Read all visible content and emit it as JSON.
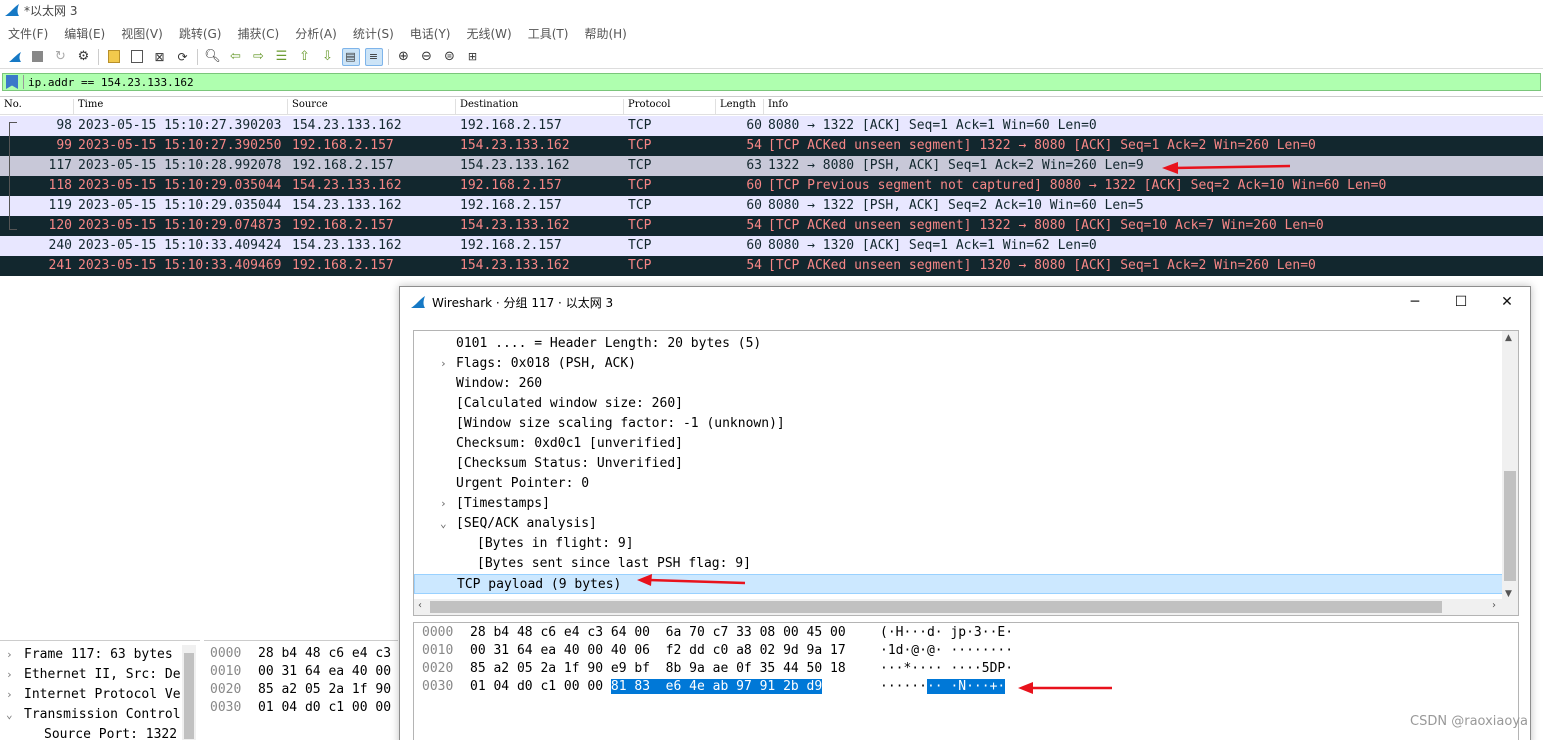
{
  "window": {
    "title": "*以太网 3"
  },
  "menu": [
    "文件(F)",
    "编辑(E)",
    "视图(V)",
    "跳转(G)",
    "捕获(C)",
    "分析(A)",
    "统计(S)",
    "电话(Y)",
    "无线(W)",
    "工具(T)",
    "帮助(H)"
  ],
  "filter": {
    "value": "ip.addr == 154.23.133.162"
  },
  "columns": [
    "No.",
    "Time",
    "Source",
    "Destination",
    "Protocol",
    "Length",
    "Info"
  ],
  "packets": [
    {
      "no": "98",
      "time": "2023-05-15 15:10:27.390203",
      "src": "154.23.133.162",
      "dst": "192.168.2.157",
      "proto": "TCP",
      "len": "60",
      "info": "8080 → 1322 [ACK] Seq=1 Ack=1 Win=60 Len=0",
      "style": "light"
    },
    {
      "no": "99",
      "time": "2023-05-15 15:10:27.390250",
      "src": "192.168.2.157",
      "dst": "154.23.133.162",
      "proto": "TCP",
      "len": "54",
      "info": "[TCP ACKed unseen segment] 1322 → 8080 [ACK] Seq=1 Ack=2 Win=260 Len=0",
      "style": "dark"
    },
    {
      "no": "117",
      "time": "2023-05-15 15:10:28.992078",
      "src": "192.168.2.157",
      "dst": "154.23.133.162",
      "proto": "TCP",
      "len": "63",
      "info": "1322 → 8080 [PSH, ACK] Seq=1 Ack=2 Win=260 Len=9",
      "style": "sel"
    },
    {
      "no": "118",
      "time": "2023-05-15 15:10:29.035044",
      "src": "154.23.133.162",
      "dst": "192.168.2.157",
      "proto": "TCP",
      "len": "60",
      "info": "[TCP Previous segment not captured] 8080 → 1322 [ACK] Seq=2 Ack=10 Win=60 Len=0",
      "style": "dark"
    },
    {
      "no": "119",
      "time": "2023-05-15 15:10:29.035044",
      "src": "154.23.133.162",
      "dst": "192.168.2.157",
      "proto": "TCP",
      "len": "60",
      "info": "8080 → 1322 [PSH, ACK] Seq=2 Ack=10 Win=60 Len=5",
      "style": "light"
    },
    {
      "no": "120",
      "time": "2023-05-15 15:10:29.074873",
      "src": "192.168.2.157",
      "dst": "154.23.133.162",
      "proto": "TCP",
      "len": "54",
      "info": "[TCP ACKed unseen segment] 1322 → 8080 [ACK] Seq=10 Ack=7 Win=260 Len=0",
      "style": "dark"
    },
    {
      "no": "240",
      "time": "2023-05-15 15:10:33.409424",
      "src": "154.23.133.162",
      "dst": "192.168.2.157",
      "proto": "TCP",
      "len": "60",
      "info": "8080 → 1320 [ACK] Seq=1 Ack=1 Win=62 Len=0",
      "style": "light"
    },
    {
      "no": "241",
      "time": "2023-05-15 15:10:33.409469",
      "src": "192.168.2.157",
      "dst": "154.23.133.162",
      "proto": "TCP",
      "len": "54",
      "info": "[TCP ACKed unseen segment] 1320 → 8080 [ACK] Seq=1 Ack=2 Win=260 Len=0",
      "style": "dark"
    }
  ],
  "detail_pane": [
    {
      "chev": "›",
      "text": "Frame 117: 63 bytes"
    },
    {
      "chev": "›",
      "text": "Ethernet II, Src: De"
    },
    {
      "chev": "›",
      "text": "Internet Protocol Ve"
    },
    {
      "chev": "⌄",
      "text": "Transmission Control"
    },
    {
      "chev": "",
      "text": "Source Port: 1322"
    }
  ],
  "bytes_pane": [
    {
      "off": "0000",
      "hex": "28 b4 48 c6 e4 c3"
    },
    {
      "off": "0010",
      "hex": "00 31 64 ea 40 00"
    },
    {
      "off": "0020",
      "hex": "85 a2 05 2a 1f 90"
    },
    {
      "off": "0030",
      "hex": "01 04 d0 c1 00 00"
    }
  ],
  "dialog": {
    "title": "Wireshark · 分组 117 · 以太网 3",
    "tree": [
      {
        "chev": "",
        "indent": 0,
        "text": "0101 .... = Header Length: 20 bytes (5)"
      },
      {
        "chev": "›",
        "indent": 0,
        "text": "Flags: 0x018 (PSH, ACK)"
      },
      {
        "chev": "",
        "indent": 0,
        "text": "Window: 260"
      },
      {
        "chev": "",
        "indent": 0,
        "text": "[Calculated window size: 260]"
      },
      {
        "chev": "",
        "indent": 0,
        "text": "[Window size scaling factor: -1 (unknown)]"
      },
      {
        "chev": "",
        "indent": 0,
        "text": "Checksum: 0xd0c1 [unverified]"
      },
      {
        "chev": "",
        "indent": 0,
        "text": "[Checksum Status: Unverified]"
      },
      {
        "chev": "",
        "indent": 0,
        "text": "Urgent Pointer: 0"
      },
      {
        "chev": "›",
        "indent": 0,
        "text": "[Timestamps]"
      },
      {
        "chev": "⌄",
        "indent": 0,
        "text": "[SEQ/ACK analysis]"
      },
      {
        "chev": "",
        "indent": 1,
        "text": "[Bytes in flight: 9]"
      },
      {
        "chev": "",
        "indent": 1,
        "text": "[Bytes sent since last PSH flag: 9]"
      },
      {
        "chev": "",
        "indent": 0,
        "text": "TCP payload (9 bytes)",
        "selected": true
      }
    ],
    "bytes": [
      {
        "off": "0000",
        "hex": "28 b4 48 c6 e4 c3 64 00  6a 70 c7 33 08 00 45 00",
        "asc": "(·H···d· jp·3··E·"
      },
      {
        "off": "0010",
        "hex": "00 31 64 ea 40 00 40 06  f2 dd c0 a8 02 9d 9a 17",
        "asc": "·1d·@·@· ········"
      },
      {
        "off": "0020",
        "hex": "85 a2 05 2a 1f 90 e9 bf  8b 9a ae 0f 35 44 50 18",
        "asc": "···*···· ····5DP·"
      },
      {
        "off": "0030",
        "hex_plain": "01 04 d0 c1 00 00 ",
        "hex_hl": "81 83  e6 4e ab 97 91 2b d9",
        "asc_plain": "······",
        "asc_hl": "·· ·N···+·"
      }
    ]
  },
  "watermark": "CSDN @raoxiaoya"
}
